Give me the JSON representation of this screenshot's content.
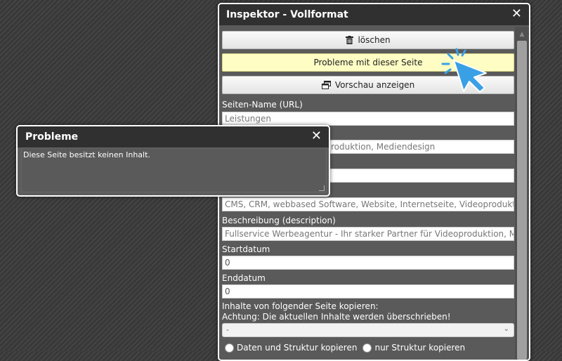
{
  "inspector": {
    "title": "Inspektor - Vollformat",
    "close_symbol": "✕",
    "delete_label": "löschen",
    "delete_icon": "trash-icon",
    "problems_label": "Probleme mit dieser Seite",
    "preview_label": "Vorschau anzeigen",
    "preview_icon": "window-restore-icon",
    "fields": {
      "page_name_label": "Seiten-Name (URL)",
      "page_name_value": "Leistungen",
      "title_value_partial": "roduktion, Mediendesign",
      "keywords_value_partial": "CMS, CRM, webbased Software, Website, Internetseite, Videoproduktion,",
      "description_label": "Beschreibung (description)",
      "description_value": "Fullservice Werbeagentur - Ihr starker Partner für Videoproduktion, Medi",
      "startdate_label": "Startdatum",
      "startdate_value": "0",
      "enddate_label": "Enddatum",
      "enddate_value": "0",
      "copy_label_line1": "Inhalte von folgender Seite kopieren:",
      "copy_label_line2": "Achtung: Die aktuellen Inhalte werden überschrieben!",
      "copy_select_value": "-",
      "radio_data_structure": "Daten und Struktur kopieren",
      "radio_structure_only": "nur Struktur kopieren"
    }
  },
  "dialog": {
    "title": "Probleme",
    "close_symbol": "✕",
    "message": "Diese Seite besitzt keinen Inhalt."
  },
  "colors": {
    "accent_cursor": "#3aa0e6",
    "warn_button": "#fdfdc4",
    "titlebar": "#303030"
  }
}
